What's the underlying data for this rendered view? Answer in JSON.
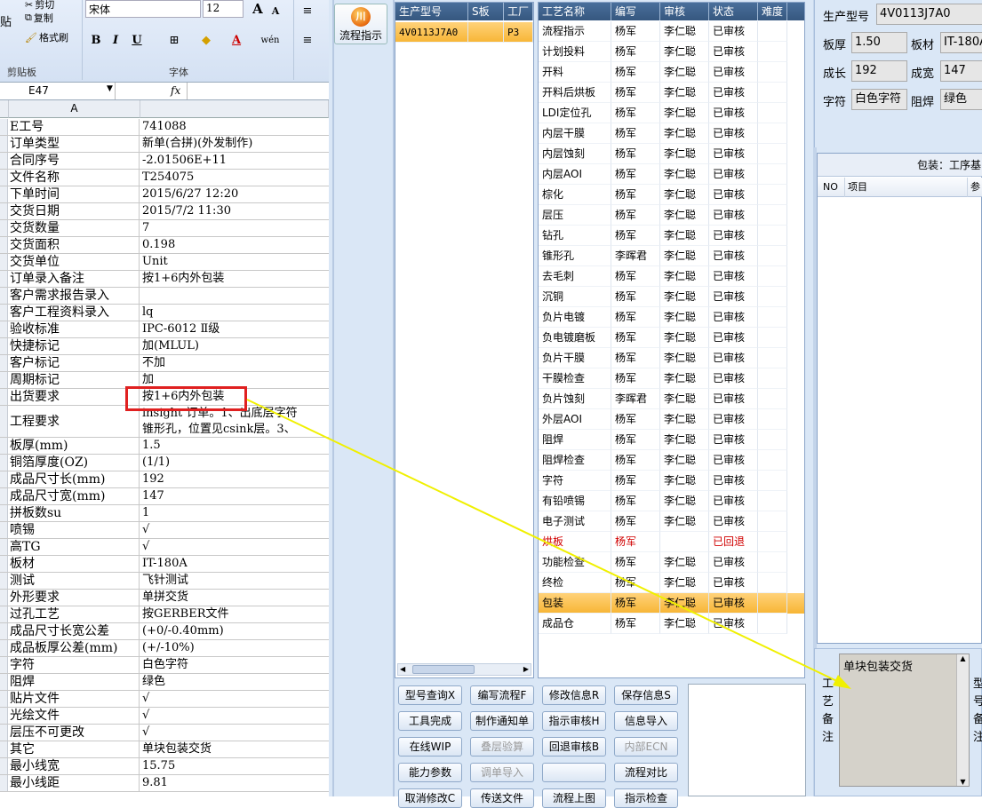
{
  "ribbon": {
    "cut": "剪切",
    "copy": "复制",
    "format_painter": "格式刷",
    "paste": "贴",
    "clipboard_label": "剪贴板",
    "font_name": "宋体",
    "font_size": "12",
    "font_label": "字体",
    "bold": "B",
    "italic": "I",
    "underline": "U",
    "grow": "A",
    "shrink": "A",
    "pinyin": "wén"
  },
  "formula": {
    "cell_ref": "E47",
    "fx": "fx"
  },
  "sheet": {
    "col_a": "A",
    "rows": [
      {
        "a": "E工号",
        "b": "741088"
      },
      {
        "a": "订单类型",
        "b": "新单(合拼)(外发制作)"
      },
      {
        "a": "合同序号",
        "b": "-2.01506E+11"
      },
      {
        "a": "文件名称",
        "b": "T254075"
      },
      {
        "a": "下单时间",
        "b": "2015/6/27 12:20"
      },
      {
        "a": "交货日期",
        "b": "2015/7/2 11:30"
      },
      {
        "a": "交货数量",
        "b": "7"
      },
      {
        "a": "交货面积",
        "b": "0.198"
      },
      {
        "a": "交货单位",
        "b": "Unit"
      },
      {
        "a": "订单录入备注",
        "b": "按1+6内外包装"
      },
      {
        "a": "客户需求报告录入",
        "b": ""
      },
      {
        "a": "客户工程资料录入",
        "b": "lq"
      },
      {
        "a": "验收标准",
        "b": "IPC-6012 Ⅱ级"
      },
      {
        "a": "快捷标记",
        "b": "加(MLUL)"
      },
      {
        "a": "客户标记",
        "b": "不加"
      },
      {
        "a": "周期标记",
        "b": "加"
      },
      {
        "a": "出货要求",
        "b": "按1+6内外包装"
      },
      {
        "a": "工程要求",
        "b": "insight 订单。1、出底层字符",
        "b2": "锥形孔，位置见csink层。3、"
      },
      {
        "a": "板厚(mm)",
        "b": "1.5"
      },
      {
        "a": "铜箔厚度(OZ)",
        "b": " (1/1)"
      },
      {
        "a": "成品尺寸长(mm)",
        "b": "192"
      },
      {
        "a": "成品尺寸宽(mm)",
        "b": "147"
      },
      {
        "a": "拼板数su",
        "b": "1"
      },
      {
        "a": "喷锡",
        "b": "√"
      },
      {
        "a": "高TG",
        "b": "√"
      },
      {
        "a": "板材",
        "b": "IT-180A"
      },
      {
        "a": "测试",
        "b": "飞针测试"
      },
      {
        "a": "外形要求",
        "b": "单拼交货"
      },
      {
        "a": "过孔工艺",
        "b": "按GERBER文件"
      },
      {
        "a": "成品尺寸长宽公差",
        "b": "(+0/-0.40mm)"
      },
      {
        "a": "成品板厚公差(mm)",
        "b": "(+/-10%)"
      },
      {
        "a": "字符",
        "b": "白色字符"
      },
      {
        "a": "阻焊",
        "b": "绿色"
      },
      {
        "a": "贴片文件",
        "b": "√"
      },
      {
        "a": "光绘文件",
        "b": "√"
      },
      {
        "a": "层压不可更改",
        "b": "√"
      },
      {
        "a": "其它",
        "b": "单块包装交货"
      },
      {
        "a": "最小线宽",
        "b": "15.75"
      },
      {
        "a": "最小线距",
        "b": "9.81"
      }
    ]
  },
  "app": {
    "flow_button": "流程指示",
    "flow_icon_text": "川",
    "model_table": {
      "headers": [
        "生产型号",
        "S板",
        "工厂"
      ],
      "rows": [
        {
          "model": "4V0113J7A0",
          "s": "",
          "factory": "P3"
        }
      ]
    },
    "process_table": {
      "headers": [
        "工艺名称",
        "编写",
        "审核",
        "状态",
        "难度"
      ],
      "rows": [
        {
          "name": "流程指示",
          "writer": "杨军",
          "reviewer": "李仁聪",
          "status": "已审核"
        },
        {
          "name": "计划投料",
          "writer": "杨军",
          "reviewer": "李仁聪",
          "status": "已审核"
        },
        {
          "name": "开料",
          "writer": "杨军",
          "reviewer": "李仁聪",
          "status": "已审核"
        },
        {
          "name": "开料后烘板",
          "writer": "杨军",
          "reviewer": "李仁聪",
          "status": "已审核"
        },
        {
          "name": "LDI定位孔",
          "writer": "杨军",
          "reviewer": "李仁聪",
          "status": "已审核"
        },
        {
          "name": "内层干膜",
          "writer": "杨军",
          "reviewer": "李仁聪",
          "status": "已审核"
        },
        {
          "name": "内层蚀刻",
          "writer": "杨军",
          "reviewer": "李仁聪",
          "status": "已审核"
        },
        {
          "name": "内层AOI",
          "writer": "杨军",
          "reviewer": "李仁聪",
          "status": "已审核"
        },
        {
          "name": "棕化",
          "writer": "杨军",
          "reviewer": "李仁聪",
          "status": "已审核"
        },
        {
          "name": "层压",
          "writer": "杨军",
          "reviewer": "李仁聪",
          "status": "已审核"
        },
        {
          "name": "钻孔",
          "writer": "杨军",
          "reviewer": "李仁聪",
          "status": "已审核"
        },
        {
          "name": "锥形孔",
          "writer": "李晖君",
          "reviewer": "李仁聪",
          "status": "已审核"
        },
        {
          "name": "去毛刺",
          "writer": "杨军",
          "reviewer": "李仁聪",
          "status": "已审核"
        },
        {
          "name": "沉铜",
          "writer": "杨军",
          "reviewer": "李仁聪",
          "status": "已审核"
        },
        {
          "name": "负片电镀",
          "writer": "杨军",
          "reviewer": "李仁聪",
          "status": "已审核"
        },
        {
          "name": "负电镀磨板",
          "writer": "杨军",
          "reviewer": "李仁聪",
          "status": "已审核"
        },
        {
          "name": "负片干膜",
          "writer": "杨军",
          "reviewer": "李仁聪",
          "status": "已审核"
        },
        {
          "name": "干膜检查",
          "writer": "杨军",
          "reviewer": "李仁聪",
          "status": "已审核"
        },
        {
          "name": "负片蚀刻",
          "writer": "李晖君",
          "reviewer": "李仁聪",
          "status": "已审核"
        },
        {
          "name": "外层AOI",
          "writer": "杨军",
          "reviewer": "李仁聪",
          "status": "已审核"
        },
        {
          "name": "阻焊",
          "writer": "杨军",
          "reviewer": "李仁聪",
          "status": "已审核"
        },
        {
          "name": "阻焊检查",
          "writer": "杨军",
          "reviewer": "李仁聪",
          "status": "已审核"
        },
        {
          "name": "字符",
          "writer": "杨军",
          "reviewer": "李仁聪",
          "status": "已审核"
        },
        {
          "name": "有铅喷锡",
          "writer": "杨军",
          "reviewer": "李仁聪",
          "status": "已审核"
        },
        {
          "name": "电子测试",
          "writer": "杨军",
          "reviewer": "李仁聪",
          "status": "已审核"
        },
        {
          "name": "烘板",
          "writer": "杨军",
          "reviewer": "",
          "status": "已回退"
        },
        {
          "name": "功能检查",
          "writer": "杨军",
          "reviewer": "李仁聪",
          "status": "已审核"
        },
        {
          "name": "终检",
          "writer": "杨军",
          "reviewer": "李仁聪",
          "status": "已审核"
        },
        {
          "name": "包装",
          "writer": "杨军",
          "reviewer": "李仁聪",
          "status": "已审核"
        },
        {
          "name": "成品仓",
          "writer": "杨军",
          "reviewer": "李仁聪",
          "status": "已审核"
        }
      ]
    },
    "buttons": [
      "型号查询X",
      "编写流程F",
      "修改信息R",
      "保存信息S",
      "工具完成",
      "制作通知单",
      "指示审核H",
      "信息导入",
      "在线WIP",
      "叠层验算",
      "回退审核B",
      "内部ECN",
      "能力参数",
      "调单导入",
      "",
      "流程对比",
      "取消修改C",
      "传送文件",
      "流程上图",
      "指示检查"
    ],
    "info": {
      "model_label": "生产型号",
      "model": "4V0113J7A0",
      "thickness_label": "板厚",
      "thickness": "1.50",
      "material_label": "板材",
      "material": "IT-180A",
      "length_label": "成长",
      "length": "192",
      "width_label": "成宽",
      "width": "147",
      "char_label": "字符",
      "char": "白色字符",
      "mask_label": "阻焊",
      "mask": "绿色"
    },
    "detail": {
      "title": "包装：工序基",
      "col_no": "NO",
      "col_item": "项目",
      "col_param": "参"
    },
    "remark": {
      "label": "工艺备注",
      "text": "单块包装交货",
      "label2": "型号备注"
    }
  },
  "colors": {
    "header_blue": "#3d6089",
    "selected_row": "#f7b534",
    "rollback_red": "#d00000",
    "annotation_yellow": "#f0f000",
    "highlight_box": "#e02020"
  }
}
